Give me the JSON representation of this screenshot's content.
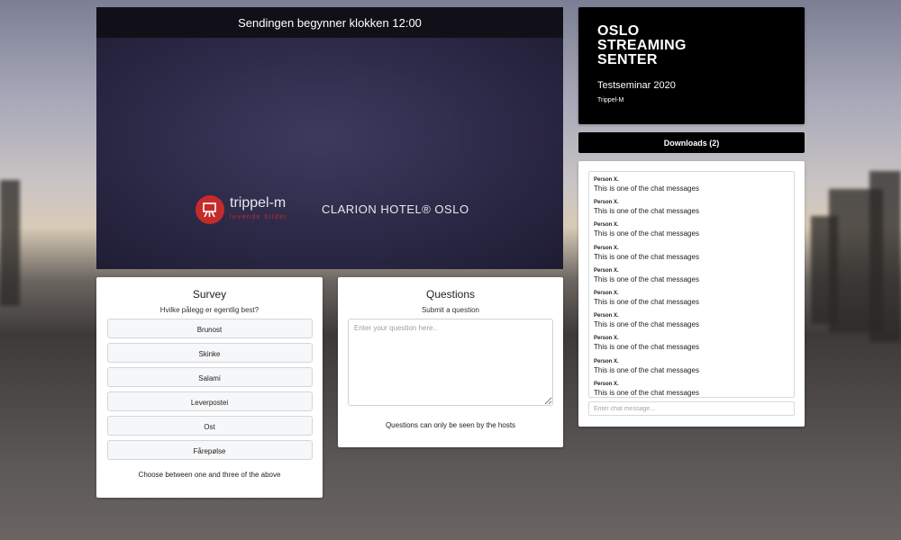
{
  "video": {
    "banner": "Sendingen begynner klokken 12:00",
    "sponsor_logo": "trippel-m",
    "sponsor_tagline": "levende bilder",
    "venue_logo": "CLARION HOTEL® OSLO"
  },
  "survey": {
    "title": "Survey",
    "question": "Hvilke pålegg er egentlig best?",
    "options": [
      "Brunost",
      "Skinke",
      "Salami",
      "Leverpostei",
      "Ost",
      "Fårepølse"
    ],
    "footer": "Choose between one and three of the above"
  },
  "questions": {
    "title": "Questions",
    "subtitle": "Submit a question",
    "placeholder": "Enter your question here..",
    "footer": "Questions can only be seen by the hosts"
  },
  "brand": {
    "name_line1": "OSLO",
    "name_line2": "STREAMING",
    "name_line3": "SENTER",
    "event": "Testseminar 2020",
    "organizer": "Trippel-M"
  },
  "downloads": {
    "label": "Downloads (2)"
  },
  "chat": {
    "messages": [
      {
        "author": "Person X.",
        "text": "This is one of the chat messages"
      },
      {
        "author": "Person X.",
        "text": "This is one of the chat messages"
      },
      {
        "author": "Person X.",
        "text": "This is one of the chat messages"
      },
      {
        "author": "Person X.",
        "text": "This is one of the chat messages"
      },
      {
        "author": "Person X.",
        "text": "This is one of the chat messages"
      },
      {
        "author": "Person X.",
        "text": "This is one of the chat messages"
      },
      {
        "author": "Person X.",
        "text": "This is one of the chat messages"
      },
      {
        "author": "Person X.",
        "text": "This is one of the chat messages"
      },
      {
        "author": "Person X.",
        "text": "This is one of the chat messages"
      },
      {
        "author": "Person X.",
        "text": "This is one of the chat messages"
      }
    ],
    "input_placeholder": "Enter chat message..."
  },
  "colors": {
    "brand_red": "#c52b2b",
    "video_bg": "#2c2947",
    "panel_dark": "#000000"
  }
}
